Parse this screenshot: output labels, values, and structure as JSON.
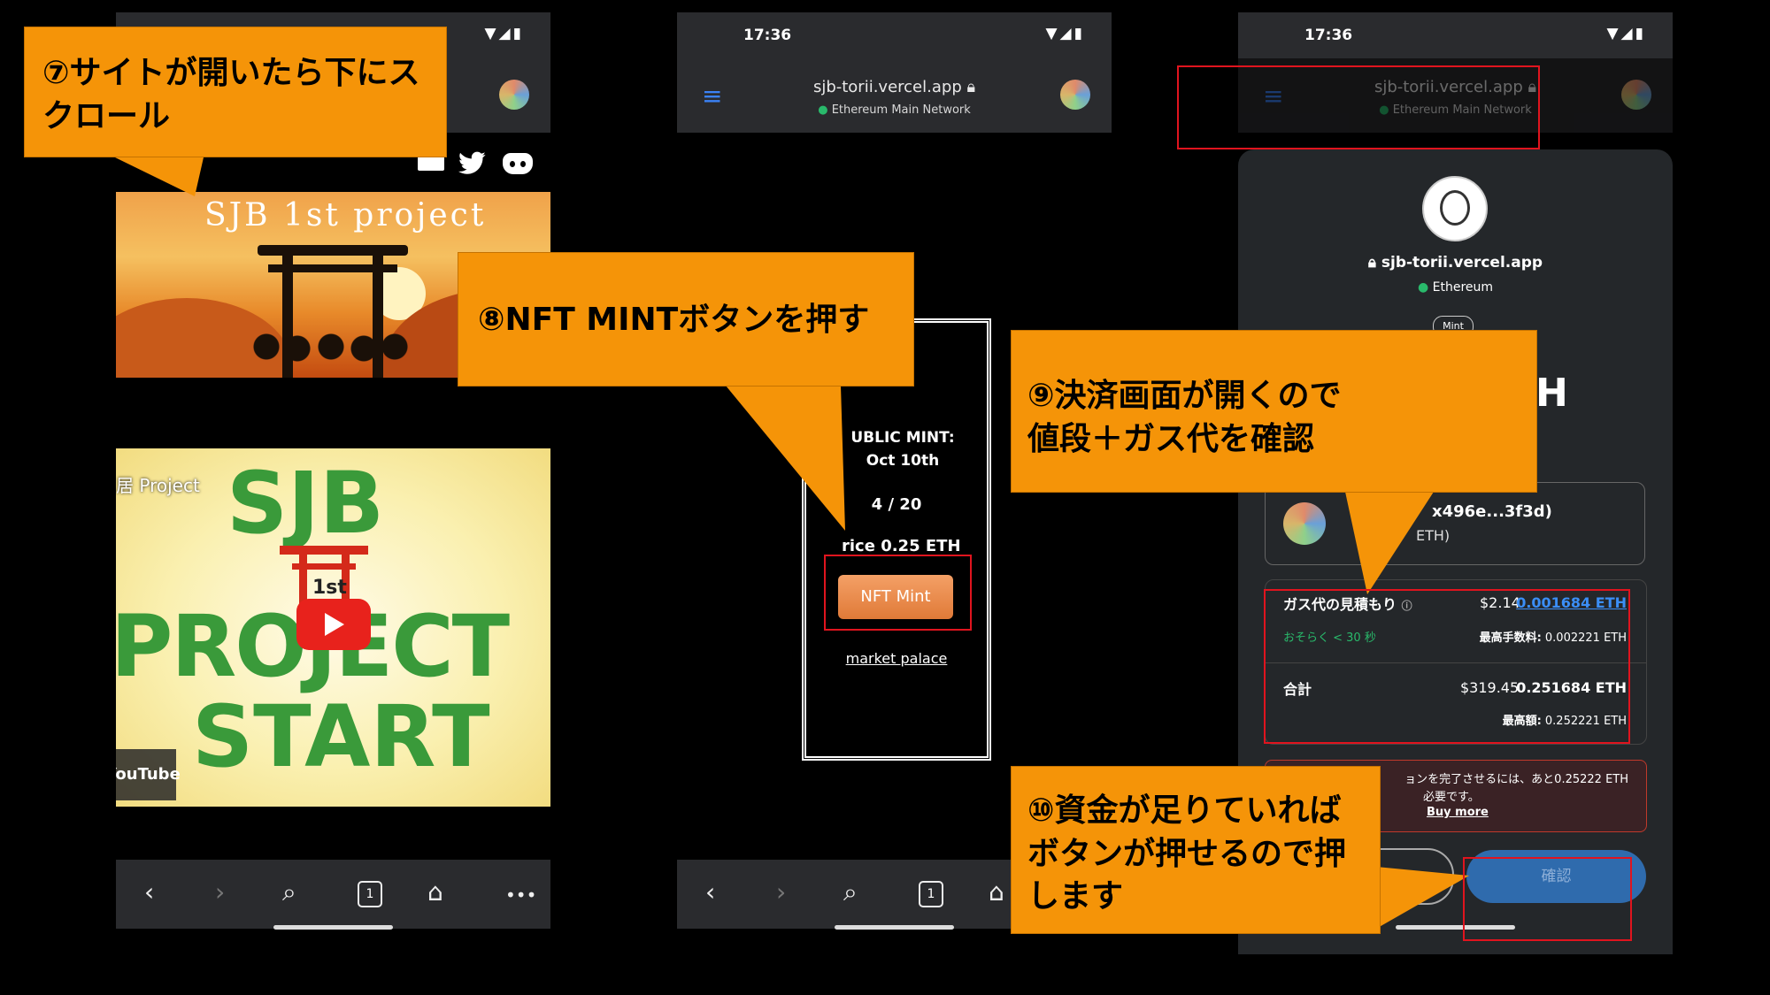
{
  "status": {
    "time": "17:36"
  },
  "browser": {
    "url": "sjb-torii.vercel.app",
    "network": "Ethereum Main Network"
  },
  "phone1": {
    "banner_title": "SJB 1st project",
    "video_title_fragment": "居 Project",
    "video_text_line1": "SJB",
    "video_text_1st": "1st",
    "video_text_line2": "PROJECT",
    "video_text_line3": "START",
    "youtube_label": "YouTube"
  },
  "phone2": {
    "mint_date": "UBLIC MINT: Oct 10th",
    "count": "4 / 20",
    "price": "rice 0.25 ETH",
    "mint_button": "NFT Mint",
    "market_link": "market palace"
  },
  "phone3": {
    "site": "sjb-torii.vercel.app",
    "chain": "Ethereum",
    "tag": "Mint",
    "account_addr": "x496e...3f3d)",
    "account_sub": "ETH)",
    "amount_fragment": "H",
    "gas_label": "ガス代の見積もり",
    "gas_usd": "$2.14",
    "gas_eth": "0.001684 ETH",
    "gas_time": "おそらく < 30 秒",
    "max_fee_label": "最高手数料:",
    "max_fee_value": "0.002221 ETH",
    "total_label": "合計",
    "total_usd": "$319.45",
    "total_eth": "0.251684 ETH",
    "max_total_label": "最高額:",
    "max_total_value": "0.252221 ETH",
    "warning_line1": "ョンを完了させるには、あと0.25222 ETH",
    "warning_line2": "必要です。",
    "buy_more": "Buy more",
    "confirm": "確認"
  },
  "callouts": {
    "c7": "⑦サイトが開いたら下にスクロール",
    "c8": "⑧NFT MINTボタンを押す",
    "c9_line1": "⑨決済画面が開くので",
    "c9_line2": "値段＋ガス代を確認",
    "c10_line1": "⑩資金が足りていれば",
    "c10_line2": "ボタンが押せるので押",
    "c10_line3": "します"
  },
  "colors": {
    "callout": "#f59408",
    "highlight": "#e0141e",
    "accent": "#3b82f6",
    "mint": "#f08a3c"
  }
}
